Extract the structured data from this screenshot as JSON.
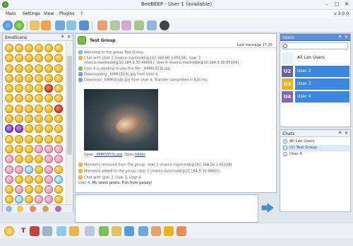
{
  "window": {
    "title": "BeeBEEP - User 1 (available)",
    "minimize_icon": "minimize-icon",
    "maximize_icon": "maximize-icon",
    "close_icon": "close-icon"
  },
  "menubar": {
    "items": [
      "Main",
      "Settings",
      "View",
      "Plugins",
      "?"
    ],
    "version": "v 3.0.0"
  },
  "emoticons_panel": {
    "title": "Emoticons",
    "pin_icon": "pin-icon",
    "close_icon": "close-icon"
  },
  "chat": {
    "group_name": "Test Group",
    "last_message": "Last message 17:25",
    "lines": [
      {
        "icon": "info-icon",
        "text": "Welcome to the group Test Group."
      },
      {
        "icon": "users-icon",
        "text": "Chat with User 2 (marco.mastroddi@192.168.56.1:65108), User 3"
      },
      {
        "icon": "",
        "text": "(marco.mastroddi@10.184.9.30:49601), User 4 (marco.mastroddi@10.184.9.30:65108)."
      },
      {
        "icon": "file-icon",
        "text": "User 4 is sending to you the file: _KMM1553s.jpg."
      },
      {
        "icon": "download-icon",
        "text": "Downloading _KMM1553s.jpg from User 4."
      },
      {
        "icon": "download-icon",
        "text": "Download _KMM1553s.jpg from User 4. Transfer completed in 625 ms."
      }
    ],
    "open_prefix": "Open",
    "open_file_link": "_KMM1553s.jpg",
    "open_folder_prefix": "Open",
    "open_folder_link": "folder",
    "lines_after": [
      {
        "icon": "users-icon",
        "text": "Members removed from the group: User 2 (marco.mastroddi@192.168.56.1:65108)."
      },
      {
        "icon": "users-icon",
        "text": "Members added to the group: User 2 (marco.mastroddi@10.184.9.30:49601)."
      },
      {
        "icon": "users-icon",
        "text": "Chat with User 2, User 3, User 4."
      }
    ],
    "last_user": "User 4:",
    "last_text": "My latest photo: Fish from galaxy!"
  },
  "users_panel": {
    "title": "Users",
    "search_placeholder": "",
    "all_lan_users": "All Lan Users",
    "users": [
      {
        "badge": "U2",
        "name": "User 2",
        "color": "#6b5ea8"
      },
      {
        "badge": "U3",
        "name": "User 3",
        "color": "#f0b21b"
      },
      {
        "badge": "U4",
        "name": "User 4",
        "color": "#8a63b8"
      }
    ]
  },
  "chats_panel": {
    "title": "Chats",
    "items": [
      {
        "name": "All Lan Users",
        "count": ""
      },
      {
        "name": "(1) Test Group",
        "count": "1"
      },
      {
        "name": "User 4",
        "count": ""
      }
    ]
  },
  "colors": {
    "accent_blue": "#2f78d6",
    "selected_blue": "#3b86e0",
    "link_blue": "#1a3fbf"
  }
}
